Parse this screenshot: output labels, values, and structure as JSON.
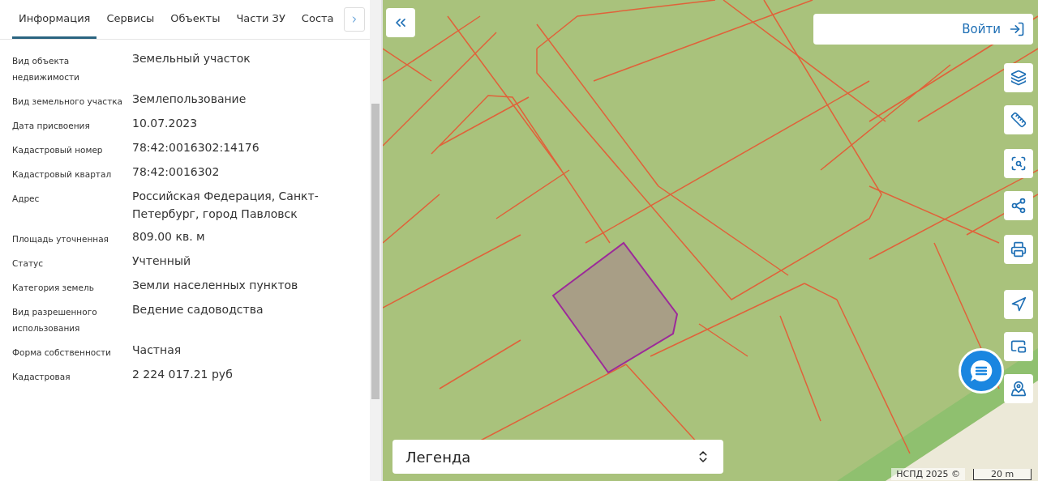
{
  "tabs": [
    {
      "label": "Информация",
      "selected": true
    },
    {
      "label": "Сервисы",
      "selected": false
    },
    {
      "label": "Объекты",
      "selected": false
    },
    {
      "label": "Части ЗУ",
      "selected": false
    },
    {
      "label": "Соста",
      "selected": false
    }
  ],
  "properties": [
    {
      "label": "Вид объекта недвижимости",
      "value": "Земельный участок"
    },
    {
      "label": "Вид земельного участка",
      "value": "Землепользование"
    },
    {
      "label": "Дата присвоения",
      "value": "10.07.2023"
    },
    {
      "label": "Кадастровый номер",
      "value": "78:42:0016302:14176"
    },
    {
      "label": "Кадастровый квартал",
      "value": "78:42:0016302"
    },
    {
      "label": "Адрес",
      "value": "Российская Федерация, Санкт-Петербург, город Павловск"
    },
    {
      "label": "Площадь уточненная",
      "value": "809.00 кв. м"
    },
    {
      "label": "Статус",
      "value": "Учтенный"
    },
    {
      "label": "Категория земель",
      "value": "Земли населенных пунктов"
    },
    {
      "label": "Вид разрешенного использования",
      "value": "Ведение садоводства"
    },
    {
      "label": "Форма собственности",
      "value": "Частная"
    },
    {
      "label": "Кадастровая",
      "value": "2 224 017.21 руб"
    }
  ],
  "map": {
    "login": "Войти",
    "legend": "Легенда",
    "attribution": "НСПД 2025 ©",
    "scale": "20 m",
    "tools": [
      {
        "kind": "layers"
      },
      {
        "kind": "ruler"
      },
      {
        "kind": "select"
      },
      {
        "kind": "share"
      },
      {
        "kind": "print"
      },
      {
        "kind": "locate"
      },
      {
        "kind": "minimap"
      },
      {
        "kind": "search"
      }
    ]
  }
}
